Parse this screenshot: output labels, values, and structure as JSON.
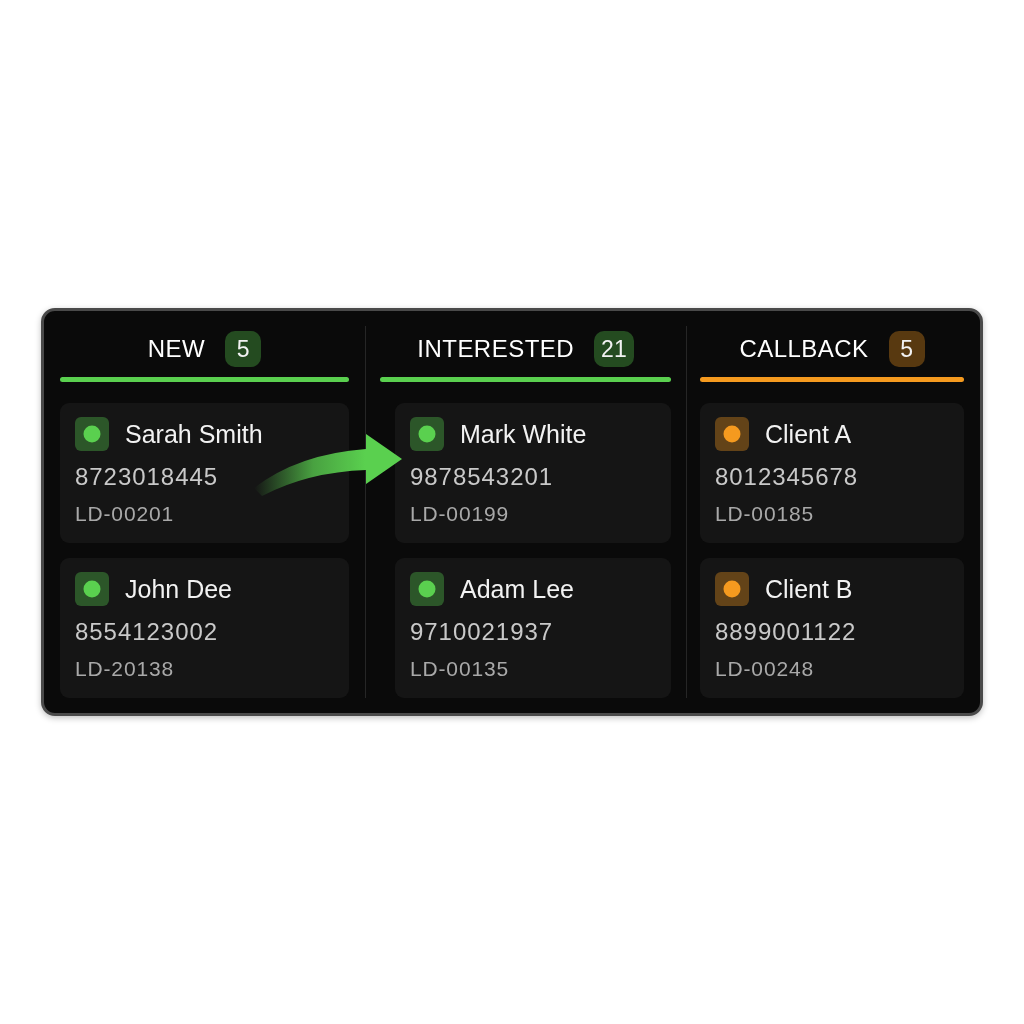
{
  "columns": [
    {
      "title": "NEW",
      "count": "5",
      "color": "#5ad04f",
      "cards": [
        {
          "name": "Sarah Smith",
          "phone": "8723018445",
          "lead_id": "LD-00201"
        },
        {
          "name": "John Dee",
          "phone": "8554123002",
          "lead_id": "LD-20138"
        }
      ]
    },
    {
      "title": "INTERESTED",
      "count": "21",
      "color": "#5ad04f",
      "cards": [
        {
          "name": "Mark White",
          "phone": "9878543201",
          "lead_id": "LD-00199"
        },
        {
          "name": "Adam Lee",
          "phone": "9710021937",
          "lead_id": "LD-00135"
        }
      ]
    },
    {
      "title": "CALLBACK",
      "count": "5",
      "color": "#f59a1f",
      "cards": [
        {
          "name": "Client A",
          "phone": "8012345678",
          "lead_id": "LD-00185"
        },
        {
          "name": "Client B",
          "phone": "8899001122",
          "lead_id": "LD-00248"
        }
      ]
    }
  ]
}
